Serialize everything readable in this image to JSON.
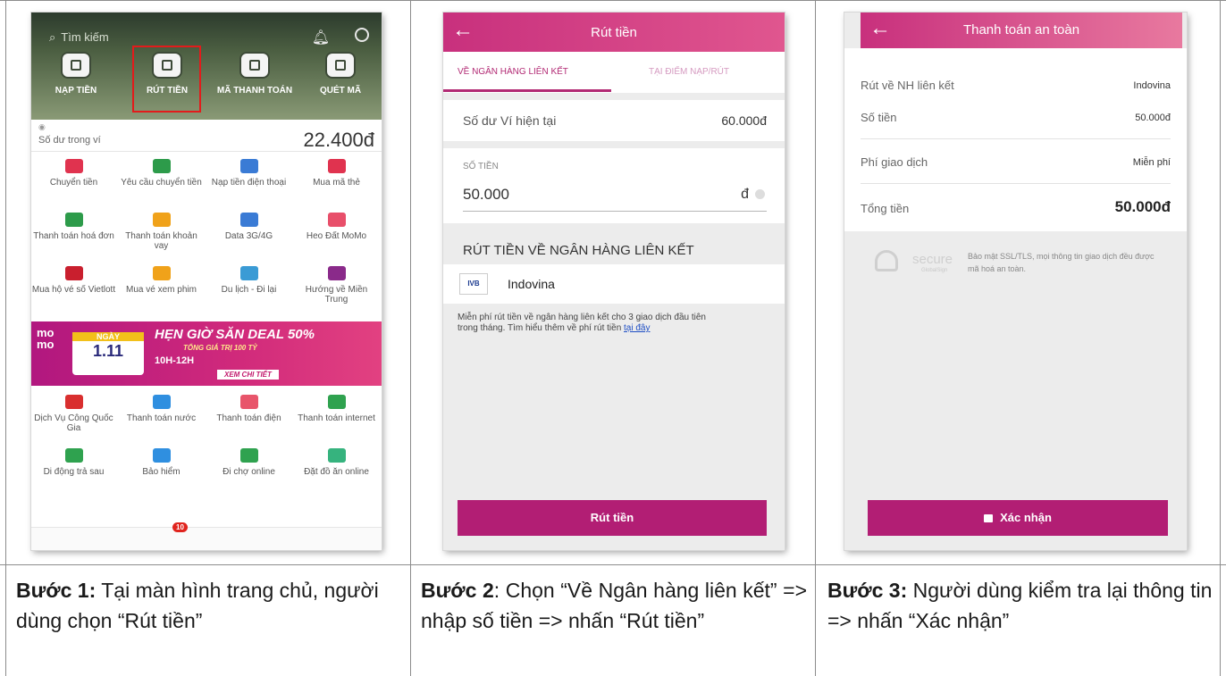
{
  "screen1": {
    "search_placeholder": "Tìm kiếm",
    "top_actions": [
      {
        "label": "NẠP TIỀN"
      },
      {
        "label": "RÚT TIỀN"
      },
      {
        "label": "MÃ THANH TOÁN"
      },
      {
        "label": "QUÉT MÃ"
      }
    ],
    "balance_label": "Số dư trong ví",
    "balance_value": "22.400đ",
    "services": [
      {
        "label": "Chuyển tiền",
        "color": "#e0334f"
      },
      {
        "label": "Yêu cầu chuyển tiền",
        "color": "#2d9b4a"
      },
      {
        "label": "Nạp tiền điện thoại",
        "color": "#3a7bd5"
      },
      {
        "label": "Mua mã thẻ",
        "color": "#e0334f"
      },
      {
        "label": "Thanh toán hoá đơn",
        "color": "#2d9b4a"
      },
      {
        "label": "Thanh toán khoản vay",
        "color": "#f0a21a"
      },
      {
        "label": "Data 3G/4G",
        "color": "#3a7bd5"
      },
      {
        "label": "Heo Đất MoMo",
        "color": "#e84f6a"
      },
      {
        "label": "Mua hộ vé số Vietlott",
        "color": "#c91f2e"
      },
      {
        "label": "Mua vé xem phim",
        "color": "#f0a21a"
      },
      {
        "label": "Du lịch - Đi lại",
        "color": "#3a9bd5"
      },
      {
        "label": "Hướng về Miền Trung",
        "color": "#8a2a8a"
      }
    ],
    "banner": {
      "brand": "mo mo",
      "day_label": "NGÀY",
      "date": "1.11",
      "title": "HẸN GIỜ SĂN DEAL 50%",
      "subtitle": "TỔNG GIÁ TRỊ 100 TỶ",
      "hours": "10H-12H",
      "cta": "XEM CHI TIẾT"
    },
    "services2": [
      {
        "label": "Dịch Vụ Công Quốc Gia",
        "color": "#d92f2f"
      },
      {
        "label": "Thanh toán nước",
        "color": "#2f8fe0"
      },
      {
        "label": "Thanh toán điện",
        "color": "#e8556b"
      },
      {
        "label": "Thanh toán internet",
        "color": "#2fa24f"
      },
      {
        "label": "Di động trả sau",
        "color": "#2fa24f"
      },
      {
        "label": "Bảo hiểm",
        "color": "#2f8fe0"
      },
      {
        "label": "Đi chợ online",
        "color": "#2fa24f"
      },
      {
        "label": "Đặt đồ ăn online",
        "color": "#36b37e"
      }
    ],
    "badge": "10"
  },
  "screen2": {
    "title": "Rút tiền",
    "tab_active": "VỀ NGÂN HÀNG LIÊN KẾT",
    "tab_inactive": "TẠI ĐIỂM NẠP/RÚT",
    "wallet_label": "Số dư Ví hiện tại",
    "wallet_value": "60.000đ",
    "amount_label": "SỐ TIỀN",
    "amount_value": "50.000",
    "currency": "đ",
    "section_title": "RÚT TIỀN VỀ NGÂN HÀNG LIÊN KẾT",
    "bank_logo": "IVB",
    "bank_name": "Indovina",
    "note": "Miễn phí rút tiền về ngân hàng liên kết cho 3 giao dịch đầu tiên trong tháng. Tìm hiểu thêm về phí rút tiền ",
    "note_link": "tại đây",
    "button": "Rút tiền"
  },
  "screen3": {
    "title": "Thanh toán an toàn",
    "rows": [
      {
        "label": "Rút về NH liên kết",
        "value": "Indovina"
      },
      {
        "label": "Số tiền",
        "value": "50.000đ"
      },
      {
        "label": "Phí giao dịch",
        "value": "Miễn phí"
      }
    ],
    "total_label": "Tổng tiền",
    "total_value": "50.000đ",
    "secure_word": "secure",
    "secure_text": "Bảo mật SSL/TLS, mọi thông tin giao dịch đều được mã hoá an toàn.",
    "button": "Xác nhận"
  },
  "captions": {
    "step1_bold": "Bước 1:",
    "step1_text": " Tại màn hình trang chủ, người dùng chọn “Rút tiền”",
    "step2_bold": "Bước 2",
    "step2_text": ": Chọn “Về Ngân hàng liên kết” => nhập số tiền => nhấn “Rút tiền”",
    "step3_bold": "Bước 3:",
    "step3_text": " Người dùng kiểm tra lại thông tin => nhấn “Xác nhận”"
  },
  "colors": {
    "brand": "#b21e74",
    "header_pink": "#c8307d",
    "highlight_box": "#e31b1b"
  }
}
